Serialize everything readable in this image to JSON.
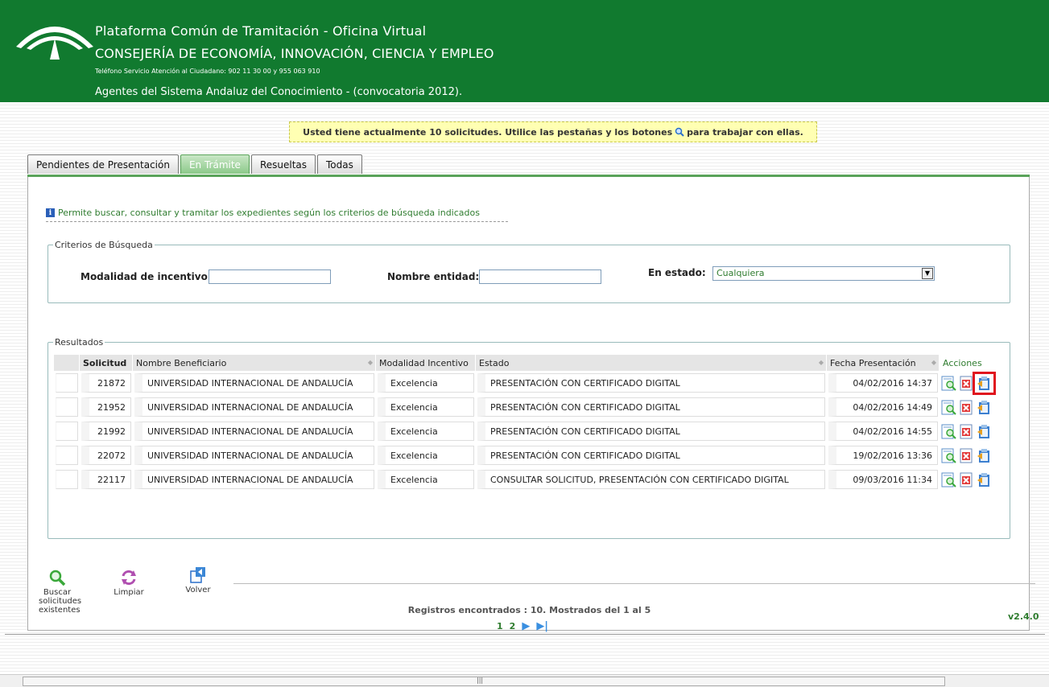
{
  "header": {
    "title": "Plataforma Común de Tramitación - Oficina Virtual",
    "consejeria": "CONSEJERÍA DE ECONOMÍA, INNOVACIÓN, CIENCIA Y EMPLEO",
    "phone": "Teléfono Servicio Atención al Ciudadano: 902 11 30 00 y 955 063 910",
    "program": "Agentes del Sistema Andaluz del Conocimiento - (convocatoria 2012)."
  },
  "notice": {
    "before": "Usted tiene actualmente 10 solicitudes. Utilice las pestañas y los botones",
    "after": "para trabajar con ellas."
  },
  "tabs": [
    {
      "label": "Pendientes de Presentación"
    },
    {
      "label": "En Trámite"
    },
    {
      "label": "Resueltas"
    },
    {
      "label": "Todas"
    }
  ],
  "info_text": "Permite buscar, consultar y tramitar los expedientes según los criterios de búsqueda indicados",
  "criteria": {
    "legend": "Criterios de Búsqueda",
    "modalidad_label": "Modalidad de incentivo:",
    "modalidad_value": "",
    "nombre_label": "Nombre entidad:",
    "nombre_value": "",
    "estado_label": "En estado:",
    "estado_value": "Cualquiera"
  },
  "results": {
    "legend": "Resultados",
    "columns": [
      "Solicitud",
      "Nombre Beneficiario",
      "Modalidad Incentivo",
      "Estado",
      "Fecha Presentación",
      "Acciones"
    ],
    "rows": [
      {
        "id": "21872",
        "nombre": "UNIVERSIDAD INTERNACIONAL DE ANDALUCÍA",
        "modalidad": "Excelencia",
        "estado": "PRESENTACIÓN CON CERTIFICADO DIGITAL",
        "fecha": "04/02/2016 14:37"
      },
      {
        "id": "21952",
        "nombre": "UNIVERSIDAD INTERNACIONAL DE ANDALUCÍA",
        "modalidad": "Excelencia",
        "estado": "PRESENTACIÓN CON CERTIFICADO DIGITAL",
        "fecha": "04/02/2016 14:49"
      },
      {
        "id": "21992",
        "nombre": "UNIVERSIDAD INTERNACIONAL DE ANDALUCÍA",
        "modalidad": "Excelencia",
        "estado": "PRESENTACIÓN CON CERTIFICADO DIGITAL",
        "fecha": "04/02/2016 14:55"
      },
      {
        "id": "22072",
        "nombre": "UNIVERSIDAD INTERNACIONAL DE ANDALUCÍA",
        "modalidad": "Excelencia",
        "estado": "PRESENTACIÓN CON CERTIFICADO DIGITAL",
        "fecha": "19/02/2016 13:36"
      },
      {
        "id": "22117",
        "nombre": "UNIVERSIDAD INTERNACIONAL DE ANDALUCÍA",
        "modalidad": "Excelencia",
        "estado": "CONSULTAR SOLICITUD, PRESENTACIÓN CON CERTIFICADO DIGITAL",
        "fecha": "09/03/2016 11:34"
      }
    ],
    "found": "Registros encontrados : 10. Mostrados del 1 al 5",
    "pages": [
      "1",
      "2"
    ]
  },
  "toolbar": {
    "buscar": "Buscar solicitudes existentes",
    "limpiar": "Limpiar",
    "volver": "Volver"
  },
  "version": "v2.4.0",
  "colors": {
    "header_green": "#117a2f",
    "accent_green": "#2f7c2f",
    "highlight_red": "#e0141e",
    "notice_yellow": "#ffffb3"
  },
  "icons": {
    "row_actions": [
      "view-icon",
      "delete-icon",
      "clipboard-icon"
    ]
  }
}
